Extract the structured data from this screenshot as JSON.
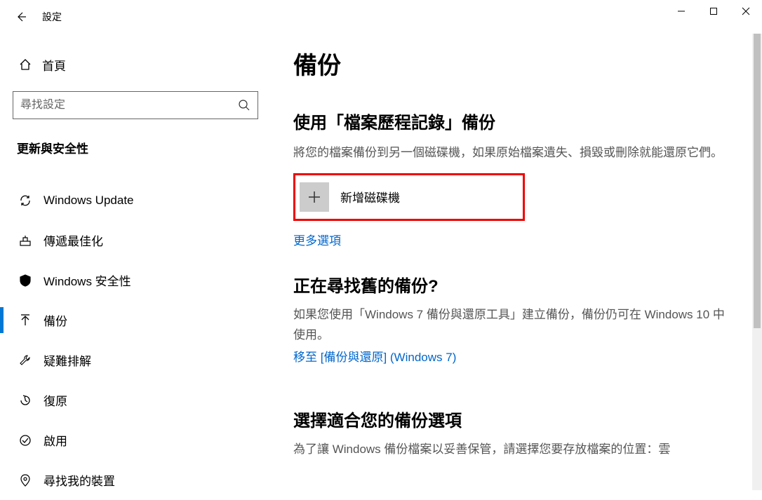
{
  "titlebar": {
    "title": "設定"
  },
  "sidebar": {
    "home_label": "首頁",
    "search_placeholder": "尋找設定",
    "category_title": "更新與安全性",
    "items": [
      {
        "label": "Windows Update"
      },
      {
        "label": "傳遞最佳化"
      },
      {
        "label": "Windows 安全性"
      },
      {
        "label": "備份"
      },
      {
        "label": "疑難排解"
      },
      {
        "label": "復原"
      },
      {
        "label": "啟用"
      },
      {
        "label": "尋找我的裝置"
      }
    ]
  },
  "main": {
    "page_title": "備份",
    "section1": {
      "title": "使用「檔案歷程記錄」備份",
      "desc": "將您的檔案備份到另一個磁碟機，如果原始檔案遺失、損毀或刪除就能還原它們。",
      "add_drive_label": "新增磁碟機",
      "more_options_link": "更多選項"
    },
    "section2": {
      "title": "正在尋找舊的備份?",
      "desc": "如果您使用「Windows 7 備份與還原工具」建立備份，備份仍可在 Windows 10 中使用。",
      "link": "移至 [備份與還原] (Windows 7)"
    },
    "section3": {
      "title": "選擇適合您的備份選項",
      "desc": "為了讓 Windows 備份檔案以妥善保管，請選擇您要存放檔案的位置：雲"
    }
  }
}
